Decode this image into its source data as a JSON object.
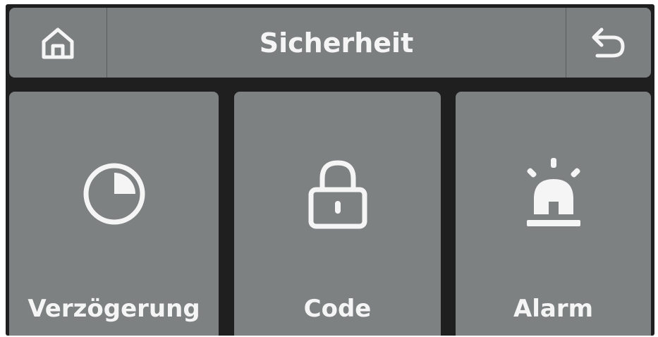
{
  "header": {
    "title": "Sicherheit",
    "home_icon": "home-icon",
    "back_icon": "back-arrow-icon"
  },
  "tiles": [
    {
      "label": "Verzögerung",
      "icon": "clock-delay-icon"
    },
    {
      "label": "Code",
      "icon": "lock-icon"
    },
    {
      "label": "Alarm",
      "icon": "alarm-siren-icon"
    }
  ],
  "colors": {
    "panel": "#7e8182",
    "background": "#1f1f20",
    "foreground": "#f5f5f5"
  }
}
